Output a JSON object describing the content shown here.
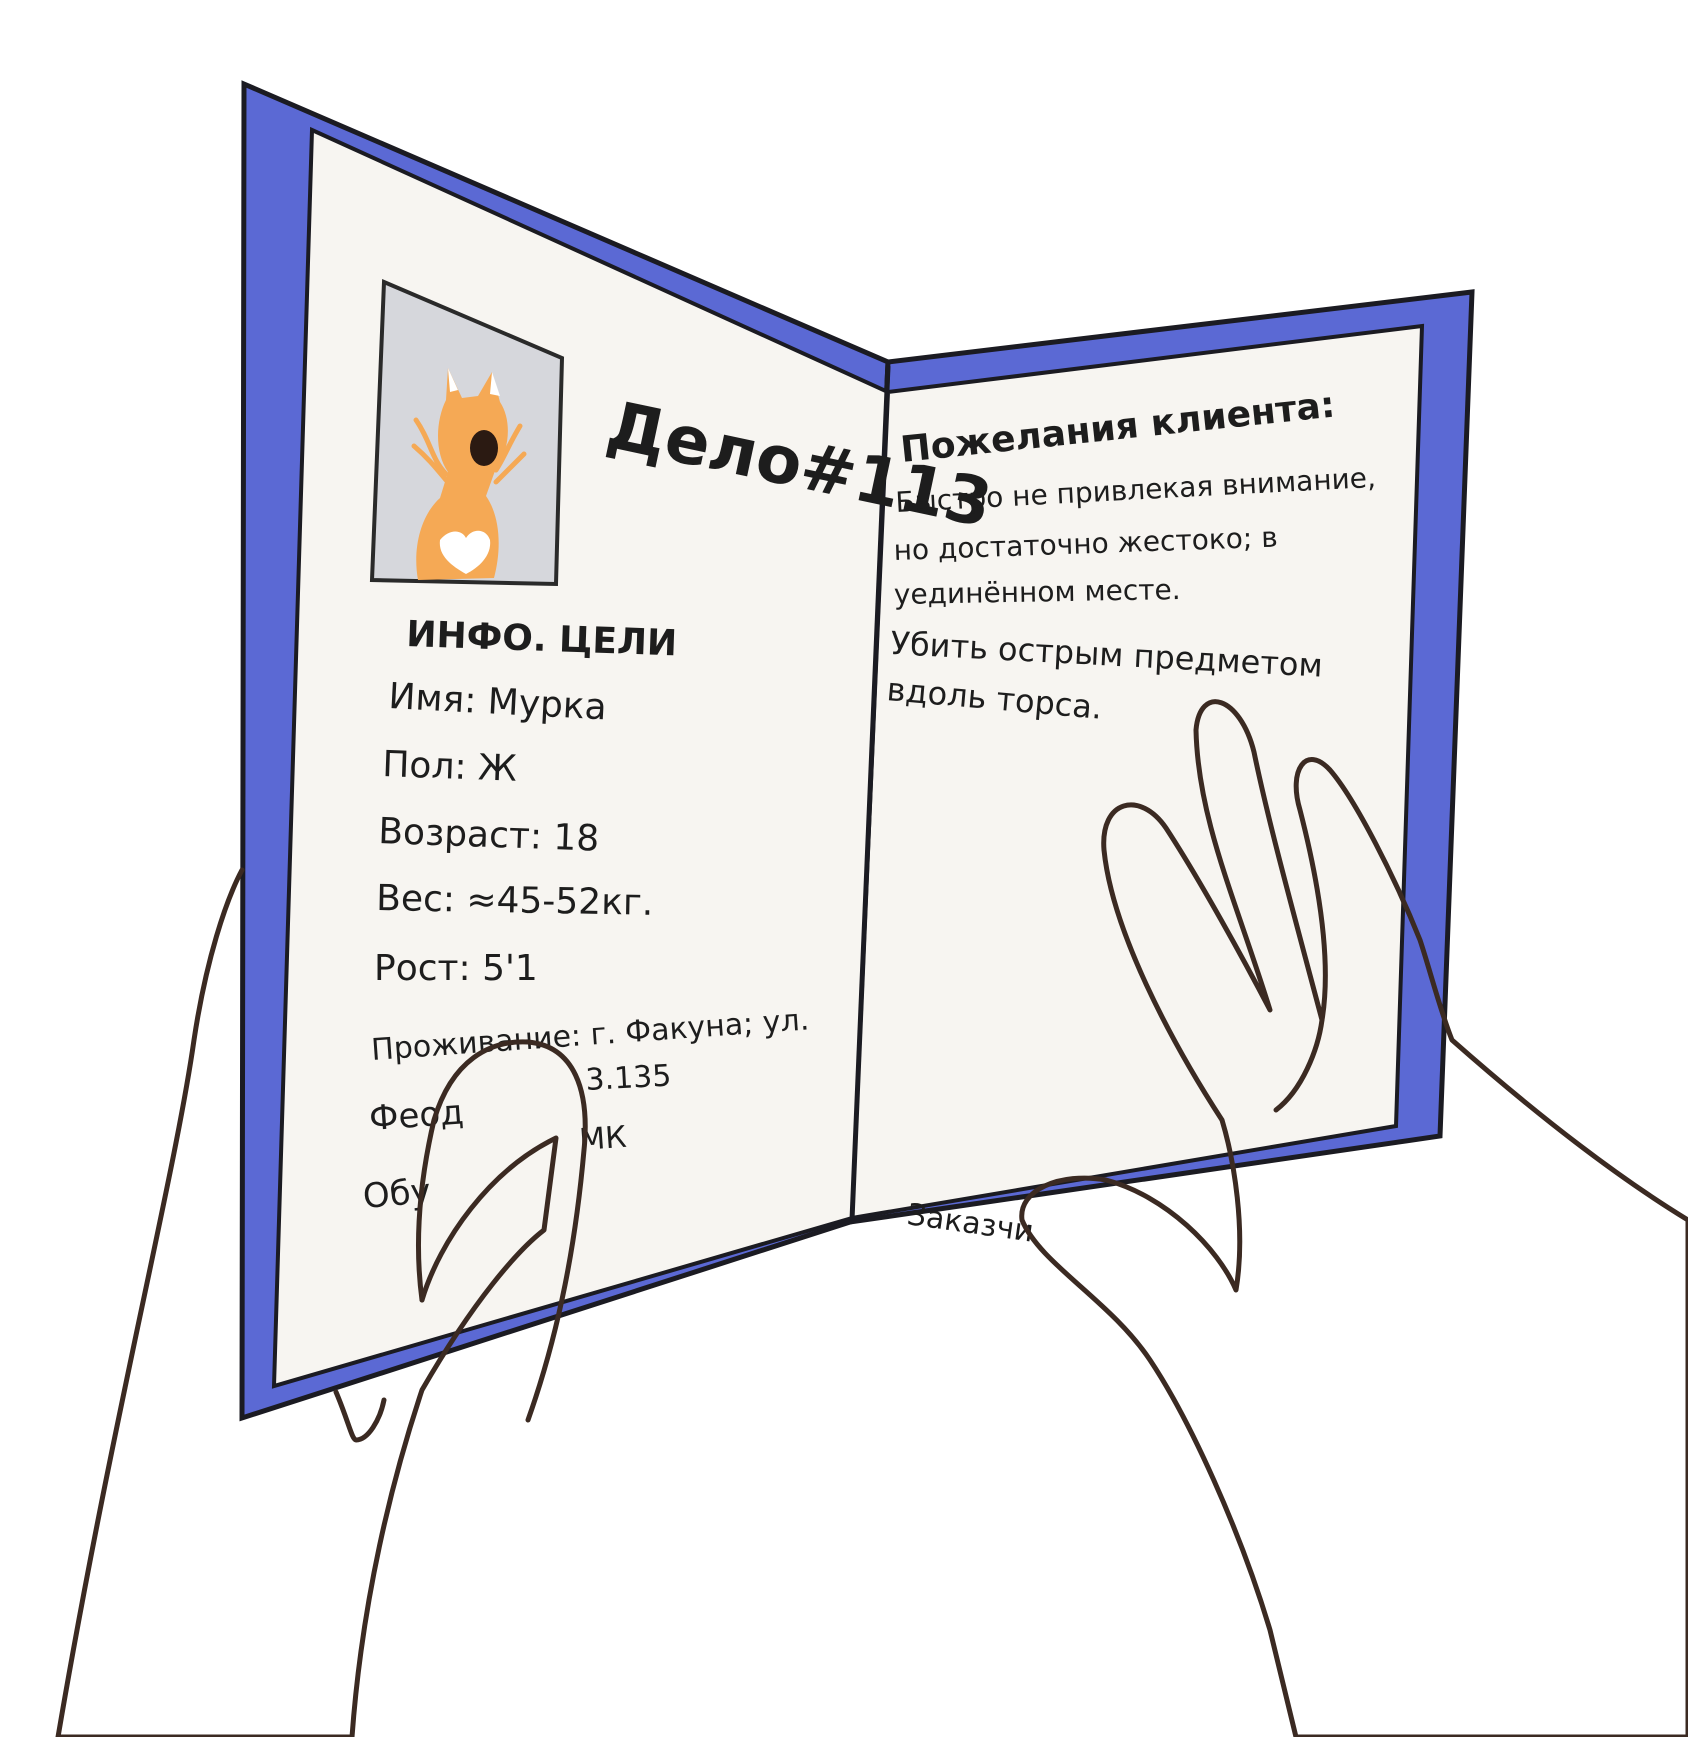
{
  "colors": {
    "cover": "#5b69d4",
    "cover_outline": "#1b1b22",
    "page": "#f7f5f1",
    "photo_bg": "#d6d7dc",
    "fox": "#f5a955",
    "skin_outline": "#3b2a22"
  },
  "left_page": {
    "case_title": "Дело#113",
    "photo_icon": "fox-portrait-icon",
    "info_heading": "ИНФО. ЦЕЛИ",
    "fields": [
      "Имя: Мурка",
      "Пол: Ж",
      "Возраст: 18",
      "Вес: ≈45-52кг.",
      "Рост: 5'1",
      "Проживание: г. Факуна; ул.",
      "3.135",
      "Феод",
      "МК",
      "Обу"
    ]
  },
  "right_page": {
    "heading": "Пожелания клиента:",
    "lines": [
      "Быстро не привлекая внимание,",
      "но достаточно жестоко; в",
      "уединённом месте.",
      "Убить острым предметом",
      "вдоль торса."
    ],
    "footer_partial": "Заказчи"
  }
}
